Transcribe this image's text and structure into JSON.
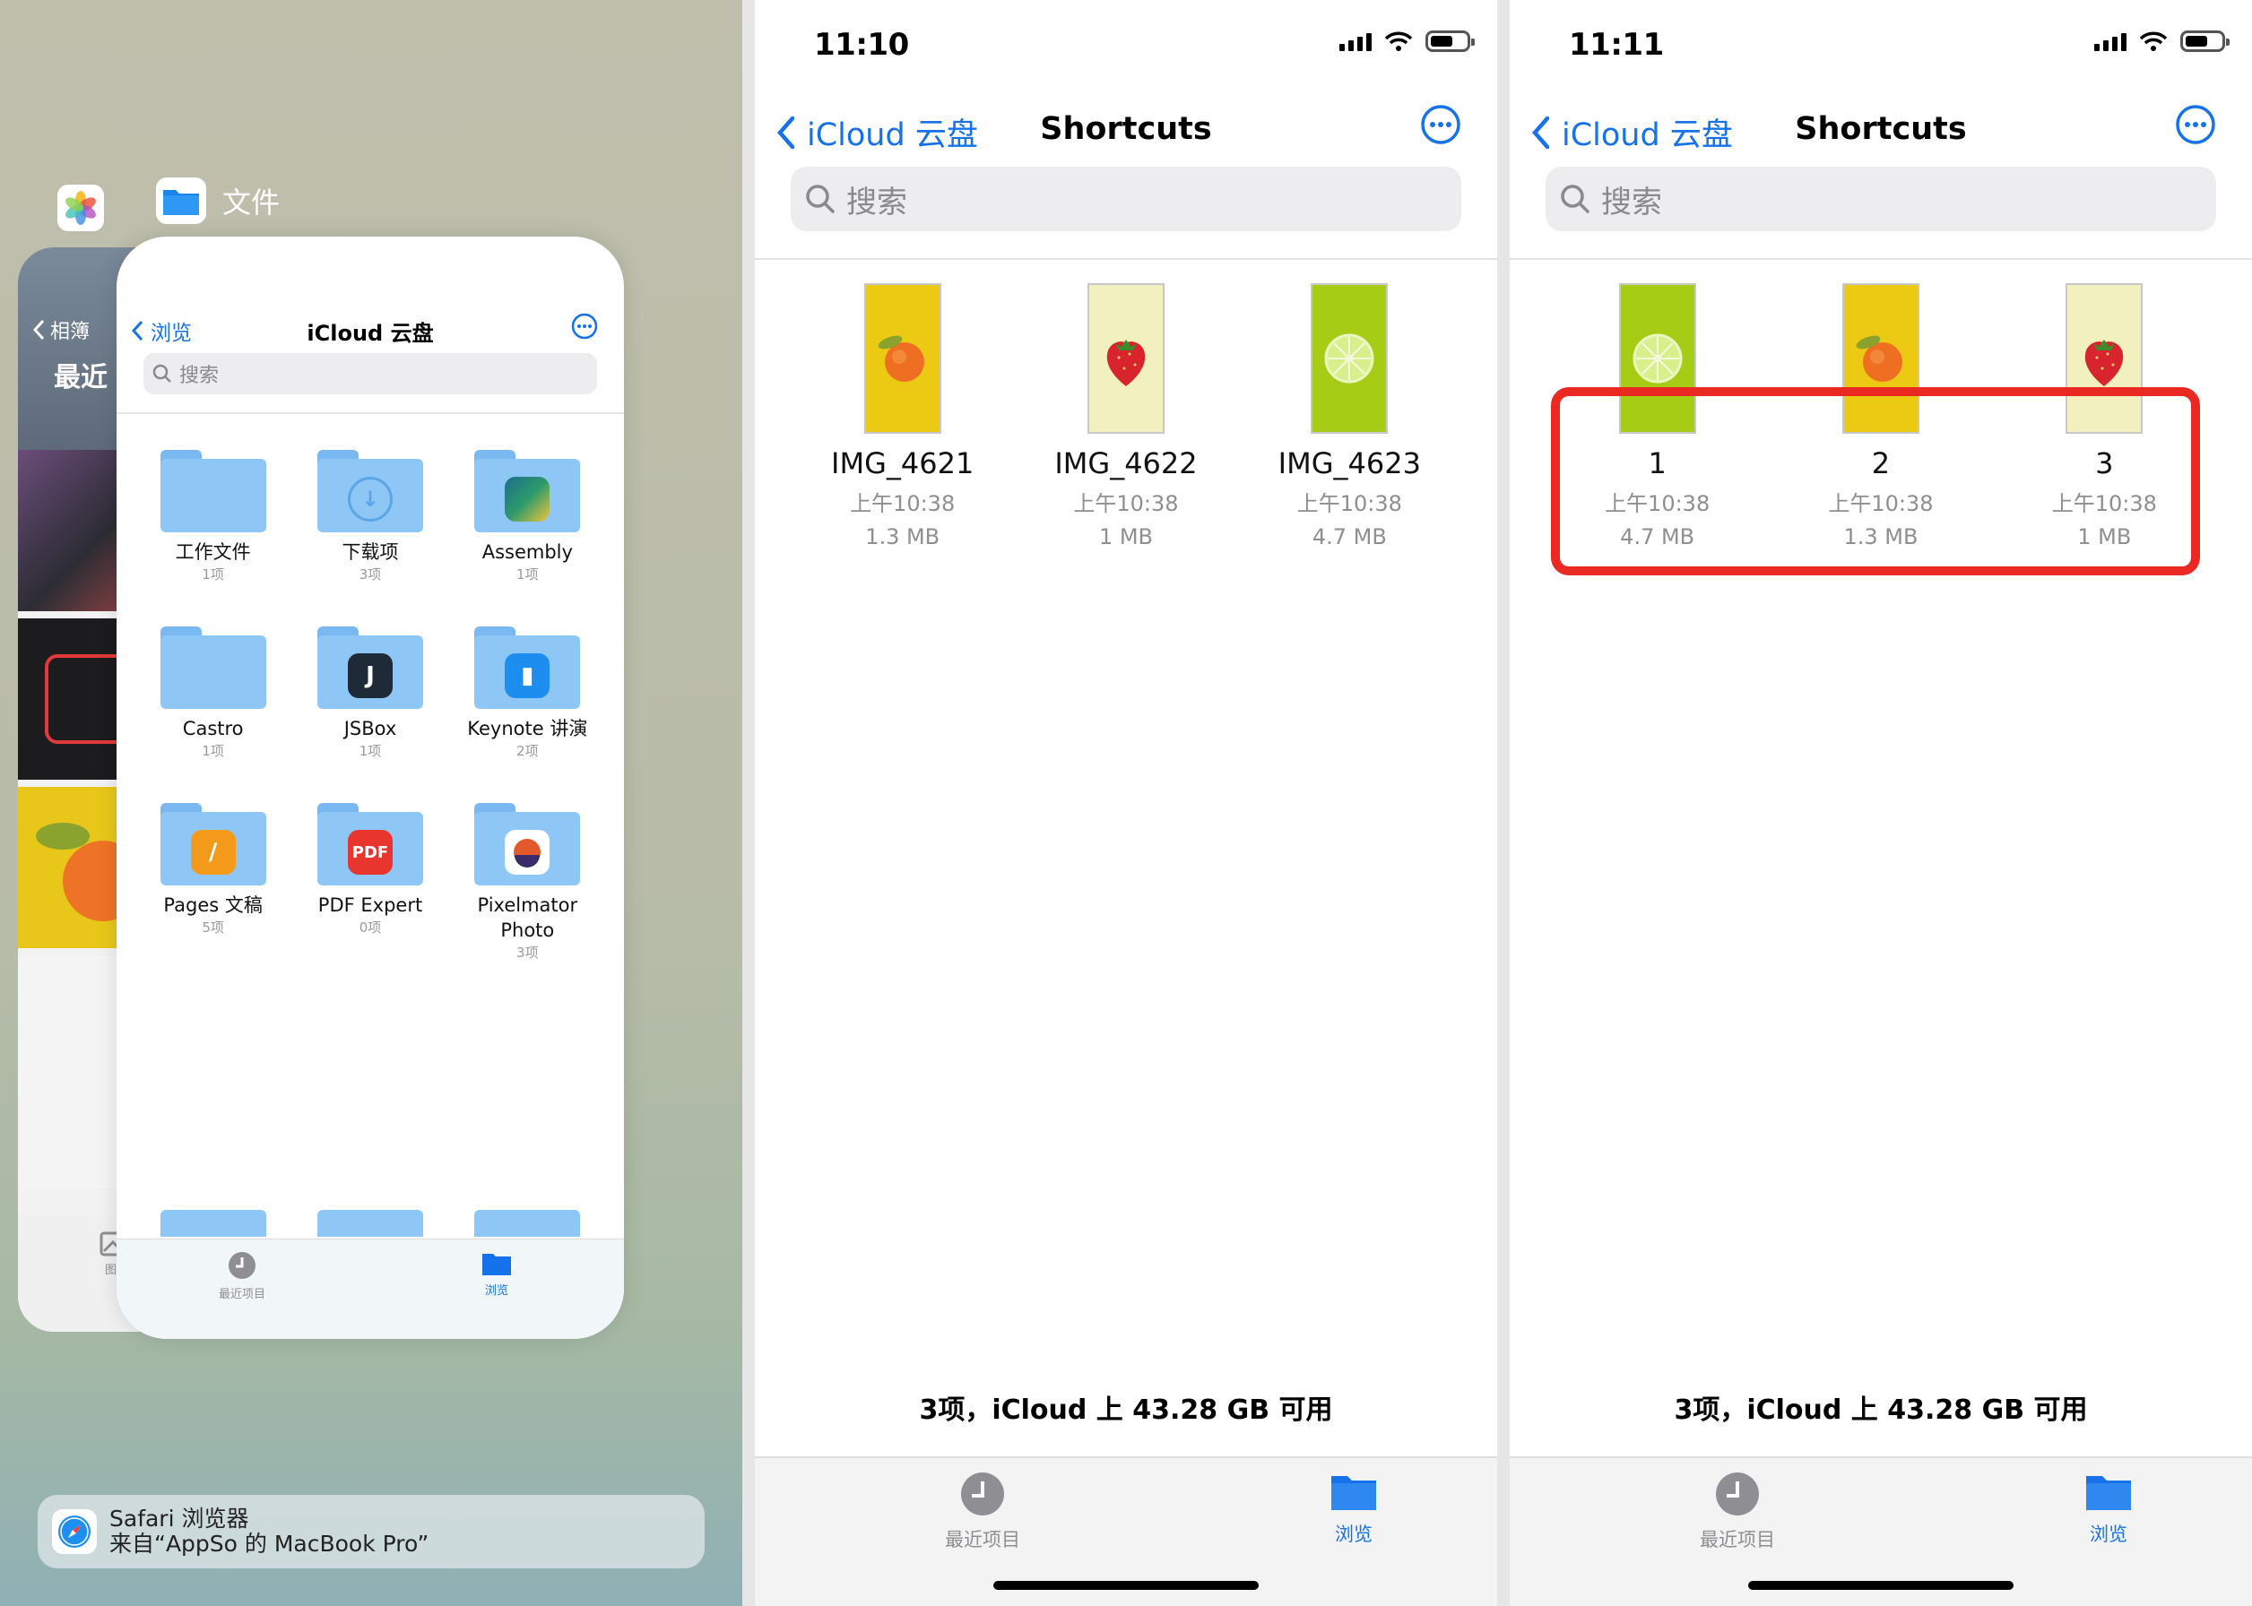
{
  "switcher": {
    "app_name": "文件",
    "files_card": {
      "back_label": "浏览",
      "title": "iCloud 云盘",
      "search_placeholder": "搜索",
      "folders": [
        {
          "name": "工作文件",
          "count": "1项",
          "badge": ""
        },
        {
          "name": "下载项",
          "count": "3项",
          "badge": "download"
        },
        {
          "name": "Assembly",
          "count": "1项",
          "badge": "assembly"
        },
        {
          "name": "Castro",
          "count": "1项",
          "badge": ""
        },
        {
          "name": "JSBox",
          "count": "1项",
          "badge": "jsbox"
        },
        {
          "name": "Keynote 讲演",
          "count": "2项",
          "badge": "keynote"
        },
        {
          "name": "Pages 文稿",
          "count": "5项",
          "badge": "pages"
        },
        {
          "name": "PDF Expert",
          "count": "0项",
          "badge": "pdfexpert"
        },
        {
          "name": "Pixelmator Photo",
          "count": "3项",
          "badge": "pixelmator"
        }
      ],
      "tabs": {
        "recent": "最近项目",
        "browse": "浏览"
      }
    },
    "photos_card": {
      "back_label": "相簿",
      "heading": "最近",
      "tab_label": "图库"
    },
    "notification": {
      "title": "Safari 浏览器",
      "subtitle": "来自“AppSo 的 MacBook Pro”"
    }
  },
  "screens": [
    {
      "time": "11:10",
      "back_label": "iCloud 云盘",
      "title": "Shortcuts",
      "search_placeholder": "搜索",
      "files": [
        {
          "name": "IMG_4621",
          "time": "上午10:38",
          "size": "1.3 MB",
          "thumb": "peach"
        },
        {
          "name": "IMG_4622",
          "time": "上午10:38",
          "size": "1 MB",
          "thumb": "strawberry"
        },
        {
          "name": "IMG_4623",
          "time": "上午10:38",
          "size": "4.7 MB",
          "thumb": "lime"
        }
      ],
      "summary": "3项，iCloud 上 43.28 GB 可用",
      "tabs": {
        "recent": "最近项目",
        "browse": "浏览"
      }
    },
    {
      "time": "11:11",
      "back_label": "iCloud 云盘",
      "title": "Shortcuts",
      "search_placeholder": "搜索",
      "files": [
        {
          "name": "1",
          "time": "上午10:38",
          "size": "4.7 MB",
          "thumb": "lime"
        },
        {
          "name": "2",
          "time": "上午10:38",
          "size": "1.3 MB",
          "thumb": "peach"
        },
        {
          "name": "3",
          "time": "上午10:38",
          "size": "1 MB",
          "thumb": "strawberry"
        }
      ],
      "summary": "3项，iCloud 上 43.28 GB 可用",
      "tabs": {
        "recent": "最近项目",
        "browse": "浏览"
      }
    }
  ],
  "colors": {
    "accent": "#1672ea",
    "highlight": "#ea2a22",
    "folder": "#8ec7f6"
  },
  "icons": [
    "chevron-left-icon",
    "more-icon",
    "search-icon",
    "clock-icon",
    "folder-icon",
    "signal-icon",
    "wifi-icon",
    "battery-icon",
    "safari-icon",
    "photos-icon",
    "files-app-icon"
  ]
}
